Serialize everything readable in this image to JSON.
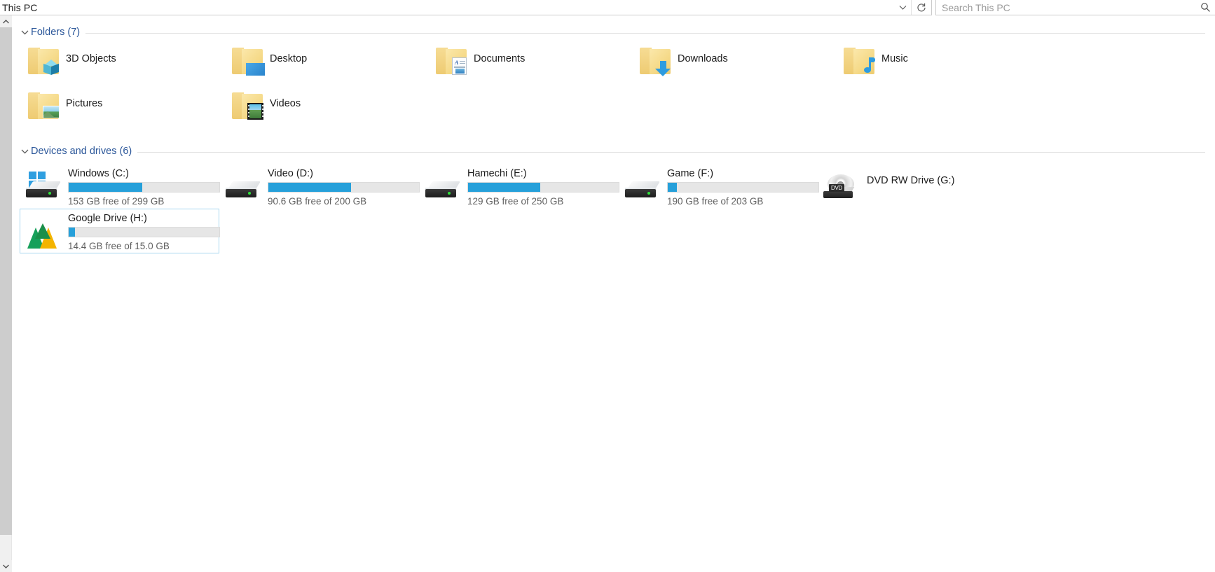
{
  "window": {
    "address_value": "This PC",
    "address_chevron_icon": "chevron-down-icon",
    "refresh_icon": "refresh-icon"
  },
  "search": {
    "placeholder": "Search This PC",
    "icon": "search-icon"
  },
  "scrollbar": {
    "up_arrow": "▲",
    "down_arrow": "▼"
  },
  "groups": [
    {
      "title": "Folders (7)",
      "chevron": "⌄"
    },
    {
      "title": "Devices and drives (6)",
      "chevron": "⌄"
    }
  ],
  "folders": [
    {
      "label": "3D Objects",
      "icon": "folder-3d-objects-icon"
    },
    {
      "label": "Desktop",
      "icon": "folder-desktop-icon"
    },
    {
      "label": "Documents",
      "icon": "folder-documents-icon"
    },
    {
      "label": "Downloads",
      "icon": "folder-downloads-icon"
    },
    {
      "label": "Music",
      "icon": "folder-music-icon"
    },
    {
      "label": "Pictures",
      "icon": "folder-pictures-icon"
    },
    {
      "label": "Videos",
      "icon": "folder-videos-icon"
    }
  ],
  "drives": [
    {
      "label": "Windows (C:)",
      "free_text": "153 GB free of 299 GB",
      "used_percent": 49,
      "icon": "windows-drive-icon",
      "selected": false,
      "has_bar": true
    },
    {
      "label": "Video (D:)",
      "free_text": "90.6 GB free of 200 GB",
      "used_percent": 55,
      "icon": "hard-drive-icon",
      "selected": false,
      "has_bar": true
    },
    {
      "label": "Hamechi (E:)",
      "free_text": "129 GB free of 250 GB",
      "used_percent": 48,
      "icon": "hard-drive-icon",
      "selected": false,
      "has_bar": true
    },
    {
      "label": "Game (F:)",
      "free_text": "190 GB free of 203 GB",
      "used_percent": 6,
      "icon": "hard-drive-icon",
      "selected": false,
      "has_bar": true
    },
    {
      "label": "DVD RW Drive (G:)",
      "free_text": "",
      "used_percent": 0,
      "icon": "dvd-drive-icon",
      "selected": false,
      "has_bar": false,
      "disc_label": "DVD"
    },
    {
      "label": "Google Drive (H:)",
      "free_text": "14.4 GB free of 15.0 GB",
      "used_percent": 4,
      "icon": "google-drive-icon",
      "selected": true,
      "has_bar": true
    }
  ],
  "colors": {
    "accent_blue": "#26a0da",
    "group_title": "#2a5699",
    "selection_border": "#a8d8f0",
    "track": "#e6e6e6"
  }
}
